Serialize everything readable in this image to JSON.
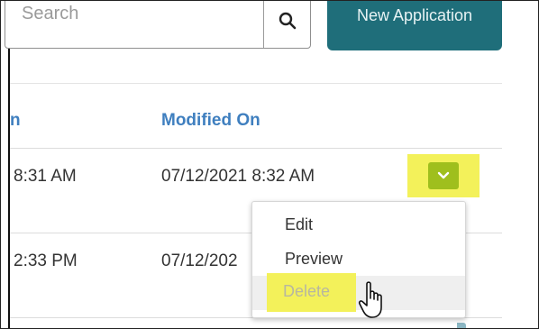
{
  "search": {
    "placeholder": "Search",
    "icon": "search-icon"
  },
  "toolbar": {
    "new_application_label": "New Application"
  },
  "table": {
    "headers": {
      "partial_prev_col": "n",
      "modified_on": "Modified On"
    },
    "rows": [
      {
        "partial_time": "8:31 AM",
        "modified_on": "07/12/2021 8:32 AM"
      },
      {
        "partial_time": "2:33 PM",
        "modified_on": "07/12/202"
      }
    ]
  },
  "row_action": {
    "icon": "chevron-down-icon",
    "highlight_color": "#f3f15a",
    "button_color": "#9fbf1d"
  },
  "menu": {
    "items": [
      {
        "label": "Edit"
      },
      {
        "label": "Preview"
      },
      {
        "label": "Delete"
      }
    ]
  },
  "colors": {
    "brand_teal": "#1f6e7a",
    "header_blue": "#3f7fbf",
    "highlight_yellow": "#f3f15a"
  }
}
